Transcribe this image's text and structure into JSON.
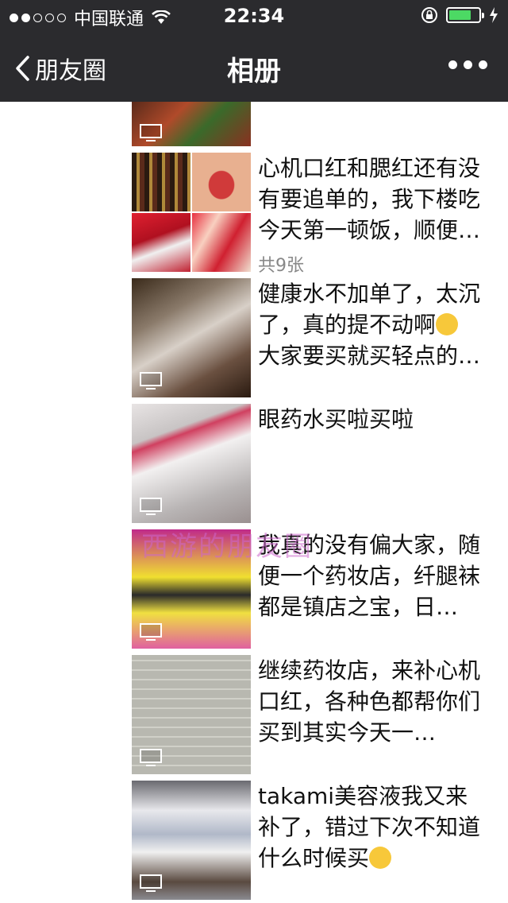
{
  "status_bar": {
    "carrier": "中国联通",
    "time": "22:34",
    "signal_dots_filled": 2,
    "signal_dots_total": 5,
    "battery_level_fraction": 0.75,
    "battery_color": "#4cd964"
  },
  "nav": {
    "back_label": "朋友圈",
    "title": "相册",
    "more_icon": "more-dots-icon",
    "background": "#2b2b2e"
  },
  "posts": [
    {
      "lines": [],
      "has_video_icon": true
    },
    {
      "lines": [
        "心机口红和腮红还有没",
        "有要追单的，我下楼吃",
        "今天第一顿饭，顺便…"
      ],
      "count": "共9张",
      "has_video_icon": false
    },
    {
      "lines": [
        "健康水不加单了，太沉",
        "了，真的提不动啊",
        "大家要买就买轻点的…"
      ],
      "has_video_icon": true
    },
    {
      "lines": [
        "眼药水买啦买啦"
      ],
      "has_video_icon": true
    },
    {
      "lines": [
        "我真的没有偏大家，随",
        "便一个药妆店，纤腿袜",
        "都是镇店之宝，日…"
      ],
      "has_video_icon": true
    },
    {
      "lines": [
        "继续药妆店，来补心机",
        "口红，各种色都帮你们",
        "买到其实今天一…"
      ],
      "has_video_icon": true
    },
    {
      "lines": [
        "takami美容液我又来",
        "补了，错过下次不知道",
        "什么时候买"
      ],
      "has_video_icon": true
    }
  ],
  "watermark": "西游的朋友圈"
}
